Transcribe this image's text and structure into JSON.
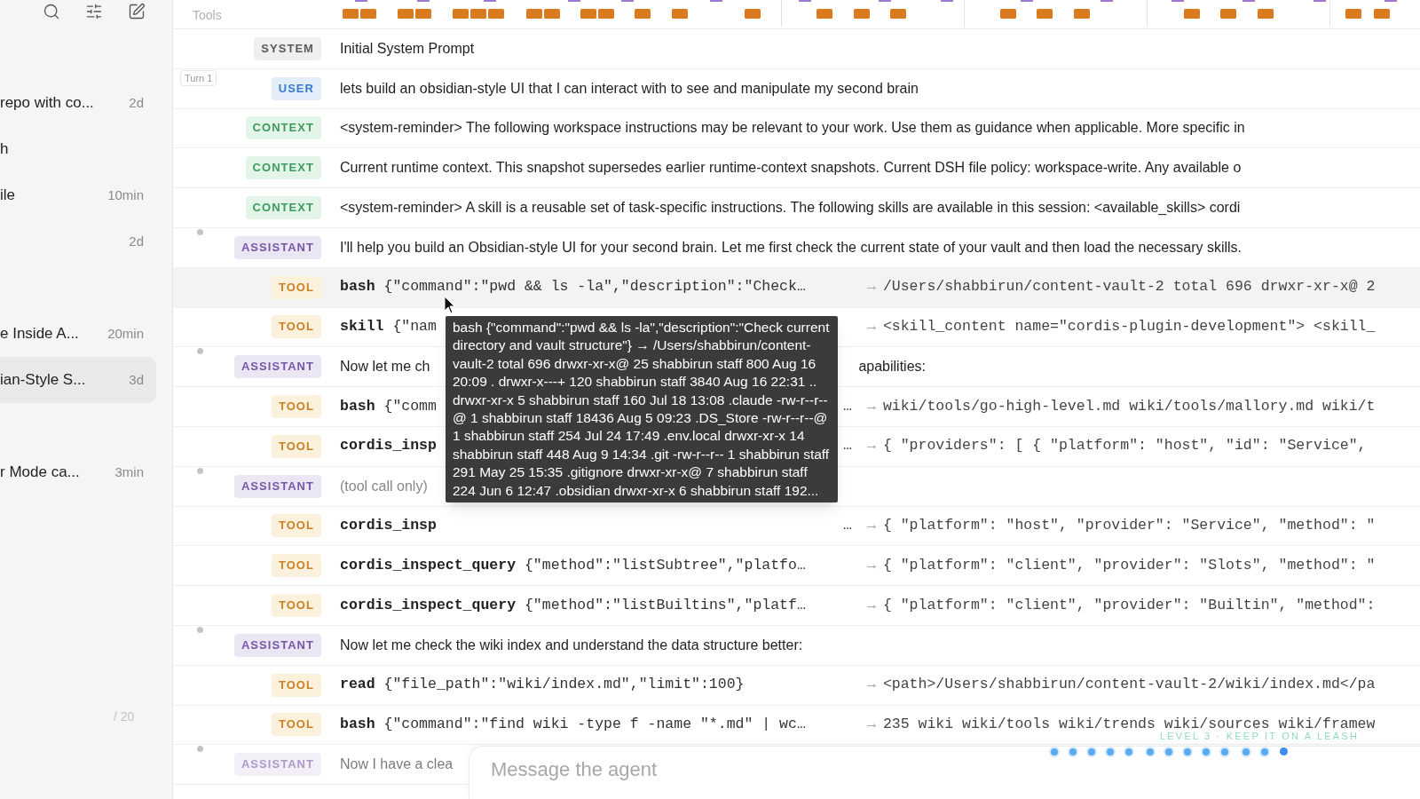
{
  "sidebar": {
    "groups": [
      {
        "items": [
          {
            "title": "repo with co...",
            "time": "2d",
            "selected": false
          },
          {
            "title": "h",
            "selected": false
          },
          {
            "title": "ile",
            "time": "10min",
            "selected": false
          },
          {
            "time": "2d",
            "selected": false
          }
        ]
      },
      {
        "items": [
          {
            "title": "e Inside A...",
            "time": "20min",
            "selected": false
          },
          {
            "title": "ian-Style S...",
            "time": "3d",
            "selected": true
          }
        ]
      },
      {
        "items": [
          {
            "title": "r Mode ca...",
            "time": "3min",
            "selected": false
          }
        ]
      }
    ],
    "page_count": "/ 20"
  },
  "timeline": {
    "label": "Tools"
  },
  "rows": [
    {
      "kind": "system",
      "role": "SYSTEM",
      "text": "Initial System Prompt",
      "selected": false,
      "dimmed": false
    },
    {
      "kind": "user",
      "role": "USER",
      "turn_label": "Turn 1",
      "text": "lets build an obsidian-style UI that I can interact with to see and manipulate my second brain",
      "selected": false,
      "dimmed": false
    },
    {
      "kind": "context",
      "role": "CONTEXT",
      "text": "<system-reminder> The following workspace instructions may be relevant to your work. Use them as guidance when applicable. More specific in",
      "selected": false,
      "dimmed": false
    },
    {
      "kind": "context",
      "role": "CONTEXT",
      "text": "Current runtime context. This snapshot supersedes earlier runtime-context snapshots. Current DSH file policy: workspace-write. Any available o",
      "selected": false,
      "dimmed": false
    },
    {
      "kind": "context",
      "role": "CONTEXT",
      "text": "<system-reminder> A skill is a reusable set of task-specific instructions. The following skills are available in this session: <available_skills> cordi",
      "selected": false,
      "dimmed": false
    },
    {
      "kind": "assistant",
      "role": "ASSISTANT",
      "text": "I'll help you build an Obsidian-style UI for your second brain. Let me first check the current state of your vault and then load the necessary skills.",
      "selected": false,
      "dimmed": false
    },
    {
      "kind": "tool",
      "role": "TOOL",
      "tool": "bash",
      "args": "{\"command\":\"pwd && ls -la\",\"description\":\"Check…",
      "arrow": "→",
      "result": "/Users/shabbirun/content-vault-2 total 696 drwxr-xr-x@ 2",
      "selected": true,
      "dimmed": false
    },
    {
      "kind": "tool",
      "role": "TOOL",
      "tool": "skill",
      "args": "{\"nam",
      "arrow": "→",
      "result": "<skill_content name=\"cordis-plugin-development\"> <skill_",
      "selected": false,
      "dimmed": false
    },
    {
      "kind": "assistant",
      "role": "ASSISTANT",
      "text": "Now let me ch",
      "text_tail": "apabilities:",
      "selected": false,
      "dimmed": false
    },
    {
      "kind": "tool",
      "role": "TOOL",
      "tool": "bash",
      "args": "{\"comm",
      "args_tail": "…",
      "arrow": "→",
      "result": "wiki/tools/go-high-level.md wiki/tools/mallory.md wiki/t",
      "selected": false,
      "dimmed": false
    },
    {
      "kind": "tool",
      "role": "TOOL",
      "tool": "cordis_insp",
      "args_tail": "…",
      "arrow": "→",
      "result": "{ \"providers\": [ { \"platform\": \"host\", \"id\": \"Service\",",
      "selected": false,
      "dimmed": false
    },
    {
      "kind": "assistant",
      "role": "ASSISTANT",
      "text": "(tool call only)",
      "selected": false,
      "dimmed": false
    },
    {
      "kind": "tool",
      "role": "TOOL",
      "tool": "cordis_insp",
      "args_tail": "…",
      "arrow": "→",
      "result": "{ \"platform\": \"host\", \"provider\": \"Service\", \"method\": \"",
      "selected": false,
      "dimmed": false
    },
    {
      "kind": "tool",
      "role": "TOOL",
      "tool": "cordis_inspect_query",
      "args": "{\"method\":\"listSubtree\",\"platfo…",
      "arrow": "→",
      "result": "{ \"platform\": \"client\", \"provider\": \"Slots\", \"method\": \"",
      "selected": false,
      "dimmed": false
    },
    {
      "kind": "tool",
      "role": "TOOL",
      "tool": "cordis_inspect_query",
      "args": "{\"method\":\"listBuiltins\",\"platf…",
      "arrow": "→",
      "result": "{ \"platform\": \"client\", \"provider\": \"Builtin\", \"method\":",
      "selected": false,
      "dimmed": false
    },
    {
      "kind": "assistant",
      "role": "ASSISTANT",
      "text": "Now let me check the wiki index and understand the data structure better:",
      "selected": false,
      "dimmed": false
    },
    {
      "kind": "tool",
      "role": "TOOL",
      "tool": "read",
      "args": "{\"file_path\":\"wiki/index.md\",\"limit\":100}",
      "arrow": "→",
      "result": "<path>/Users/shabbirun/content-vault-2/wiki/index.md</pa",
      "selected": false,
      "dimmed": false
    },
    {
      "kind": "tool",
      "role": "TOOL",
      "tool": "bash",
      "args": "{\"command\":\"find wiki -type f -name \"*.md\" | wc…",
      "arrow": "→",
      "result": "235 wiki wiki/tools wiki/trends wiki/sources wiki/framew",
      "selected": false,
      "dimmed": false
    },
    {
      "kind": "assistant",
      "role": "ASSISTANT",
      "text": "Now I have a clea",
      "selected": false,
      "dimmed": true
    }
  ],
  "tooltip": {
    "text": "bash {\"command\":\"pwd && ls -la\",\"description\":\"Check current directory and vault structure\"} → /Users/shabbirun/content-vault-2 total 696 drwxr-xr-x@ 25 shabbirun staff 800 Aug 16 20:09 . drwxr-x---+ 120 shabbirun staff 3840 Aug 16 22:31 .. drwxr-xr-x 5 shabbirun staff 160 Jul 18 13:08 .claude -rw-r--r--@ 1 shabbirun staff 18436 Aug 5 09:23 .DS_Store -rw-r--r--@ 1 shabbirun staff 254 Jul 24 17:49 .env.local drwxr-xr-x 14 shabbirun staff 448 Aug 9 14:34 .git -rw-r--r-- 1 shabbirun staff 291 May 25 15:35 .gitignore drwxr-xr-x@ 7 shabbirun staff 224 Jun 6 12:47 .obsidian drwxr-xr-x 6 shabbirun staff 192..."
  },
  "composer": {
    "placeholder": "Message the agent"
  },
  "progress": {
    "caption": "LEVEL 3 · KEEP IT ON A LEASH",
    "groups": [
      [
        {
          "selected": false
        },
        {
          "selected": false
        },
        {
          "selected": false
        },
        {
          "selected": false
        },
        {
          "selected": false
        }
      ],
      [
        {
          "selected": false
        },
        {
          "selected": false
        },
        {
          "selected": false
        },
        {
          "selected": false
        },
        {
          "selected": false
        }
      ],
      [
        {
          "selected": false
        },
        {
          "selected": false
        },
        {
          "selected": true
        }
      ]
    ]
  }
}
